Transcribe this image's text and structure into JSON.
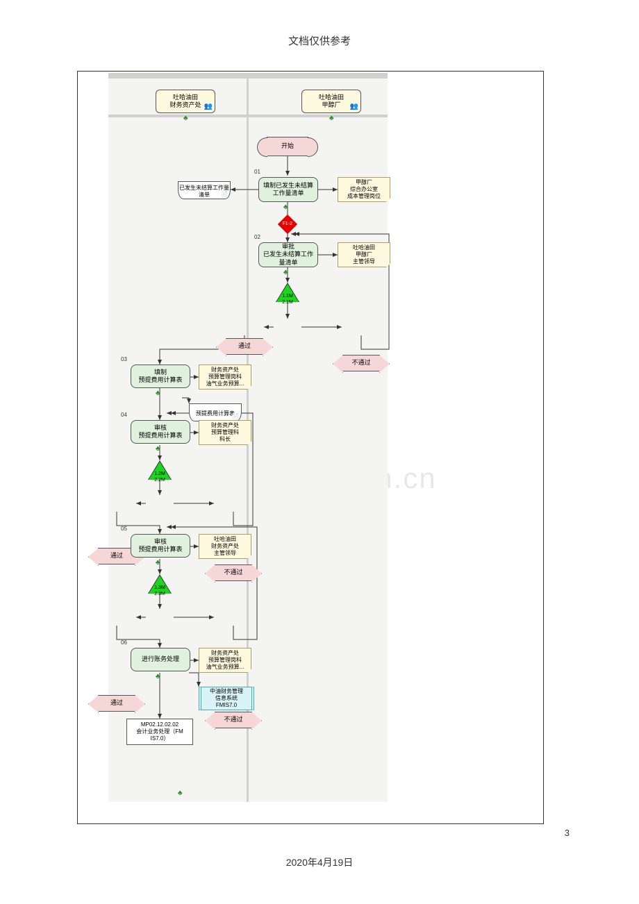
{
  "header": "文档仅供参考",
  "pageNumber": "3",
  "date": "2020年4月19日",
  "watermark": "www.zixin.com.cn",
  "pools": {
    "p1": "吐哈油田\n财务资产处",
    "p2": "吐哈油田\n甲醇厂"
  },
  "start": "开始",
  "nums": {
    "n01": "01",
    "n02": "02",
    "n03": "03",
    "n04": "04",
    "n05": "05",
    "n06": "06"
  },
  "tasks": {
    "t01": "填制已发生未结算工作量清单",
    "t02": "审批\n已发生未结算工作量清单",
    "t03": "填制\n预提费用计算表",
    "t04": "审核\n预提费用计算表",
    "t05": "审核\n预提费用计算表",
    "t06": "进行账务处理"
  },
  "notes": {
    "n01": "甲醇厂\n综合办公室\n成本管理岗位",
    "n02": "吐哈油田\n甲醇厂\n主管领导",
    "n03": "财务资产处\n预算管理岗科\n油气业务预算...",
    "n04": "财务资产处\n预算管理科\n科长",
    "n05": "吐哈油田\n财务资产处\n主管领导",
    "n06": "财务资产处\n预算管理岗科\n油气业务预算..."
  },
  "docs": {
    "d1": "已发生未结算工作量清单",
    "d2": "预提费用计算表"
  },
  "decisions": {
    "pass": "通过",
    "fail": "不通过"
  },
  "risks": {
    "r1": "F1-2",
    "r2": "1.1M\n2.1M",
    "r3": "1.2M\n2.2M",
    "r4": "1.3M\n2.3M"
  },
  "sub": "MP02.12.02.02\n会计业务处理（FM\nIS7.0）",
  "sys": "中油财务管理\n信息系统\nFMIS7.0"
}
